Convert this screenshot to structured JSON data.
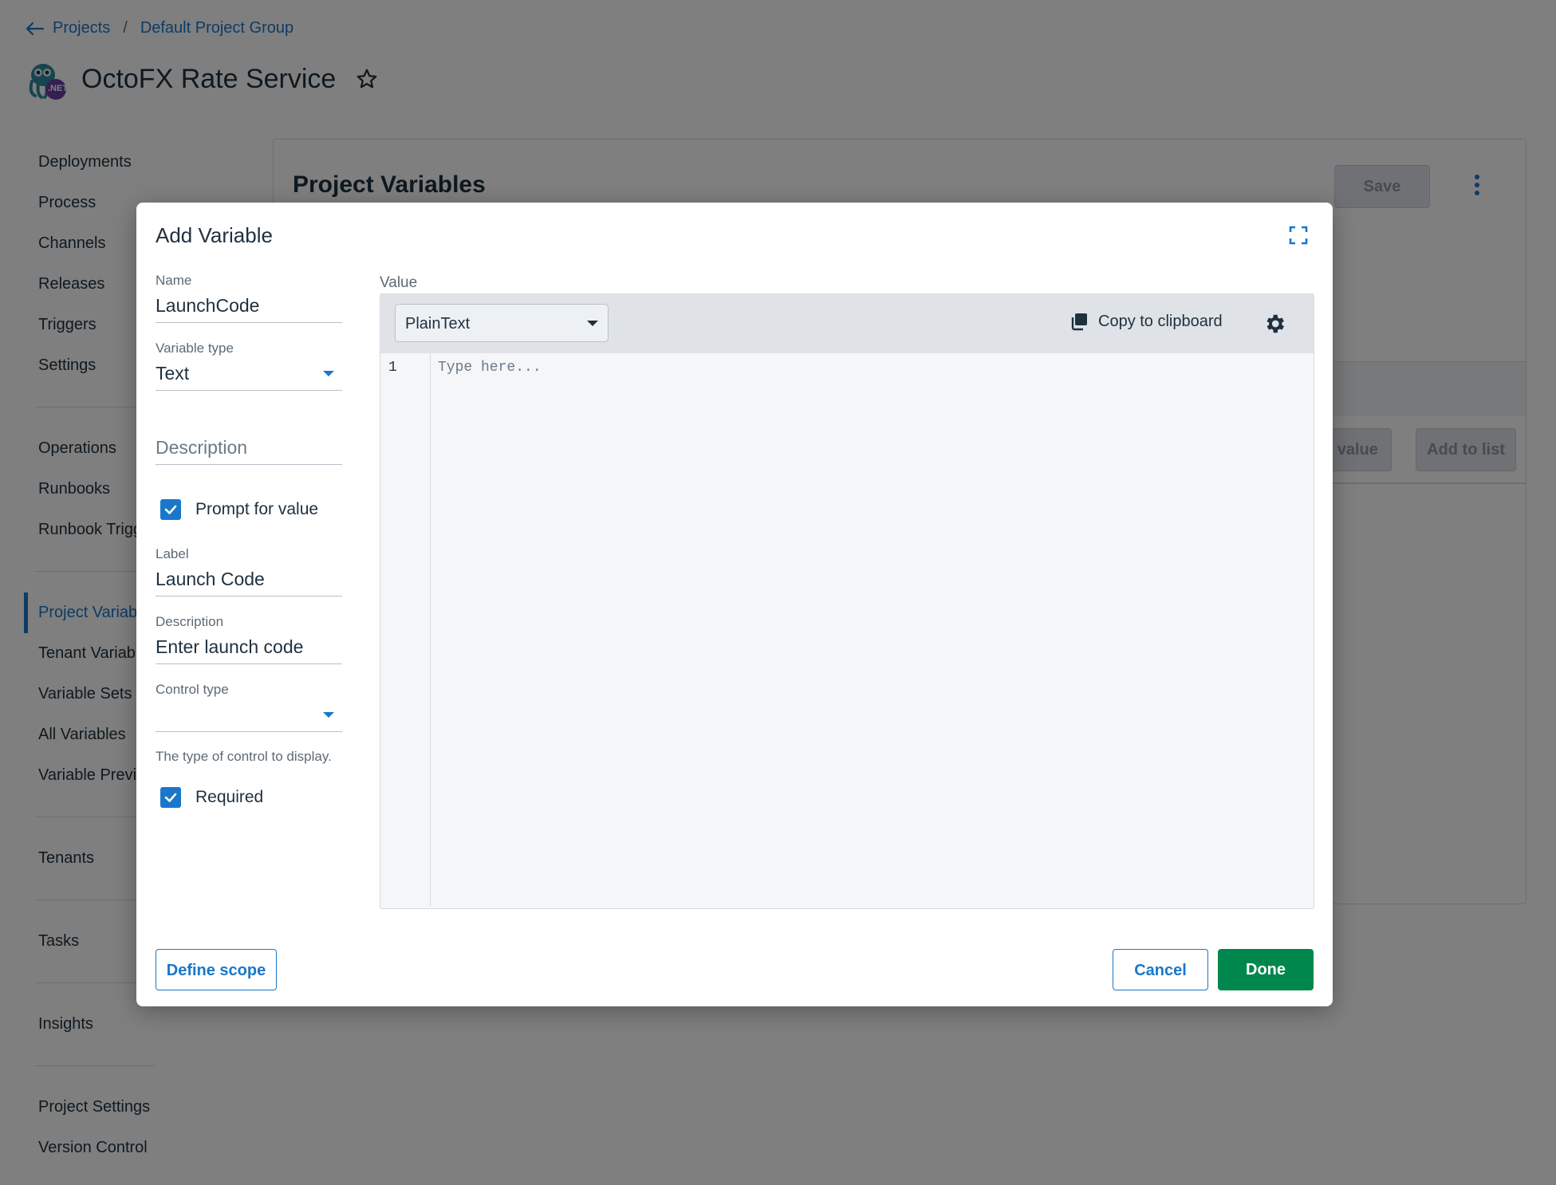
{
  "breadcrumb": {
    "projects": "Projects",
    "separator": "/",
    "group": "Default Project Group"
  },
  "project": {
    "title": "OctoFX Rate Service",
    "logo_text": ".NET"
  },
  "sidebar": {
    "groups": [
      [
        "Deployments",
        "Process",
        "Channels",
        "Releases",
        "Triggers",
        "Settings"
      ],
      [
        "Operations",
        "Runbooks",
        "Runbook Triggers"
      ],
      [
        "Project Variables",
        "Tenant Variables",
        "Variable Sets",
        "All Variables",
        "Variable Preview"
      ],
      [
        "Tenants"
      ],
      [
        "Tasks"
      ],
      [
        "Insights"
      ],
      [
        "Project Settings",
        "Version Control"
      ]
    ],
    "active": "Project Variables"
  },
  "card": {
    "title": "Project Variables",
    "save_label": "Save",
    "other_value_label": "Enter value",
    "add_to_list_label": "Add to list"
  },
  "dialog": {
    "title": "Add Variable",
    "name_label": "Name",
    "name_value": "LaunchCode",
    "variable_type_label": "Variable type",
    "variable_type_value": "Text",
    "description_placeholder": "Description",
    "prompt_label": "Prompt for value",
    "prompt_checked": true,
    "label_label": "Label",
    "label_value": "Launch Code",
    "prompt_description_label": "Description",
    "prompt_description_value": "Enter launch code",
    "control_type_label": "Control type",
    "control_type_value": "",
    "control_type_helper": "The type of control to display.",
    "required_label": "Required",
    "required_checked": true,
    "value_label": "Value",
    "syntax_value": "PlainText",
    "copy_label": "Copy to clipboard",
    "line_number": "1",
    "editor_placeholder": "Type here...",
    "define_scope_label": "Define scope",
    "cancel_label": "Cancel",
    "done_label": "Done"
  },
  "colors": {
    "accent": "#1a77ca",
    "done": "#00874d",
    "text": "#1f303f"
  },
  "icons": [
    "back-arrow-icon",
    "star-icon",
    "kebab-icon",
    "expand-icon",
    "copy-icon",
    "gear-icon",
    "check-icon",
    "chevron-down-icon"
  ]
}
